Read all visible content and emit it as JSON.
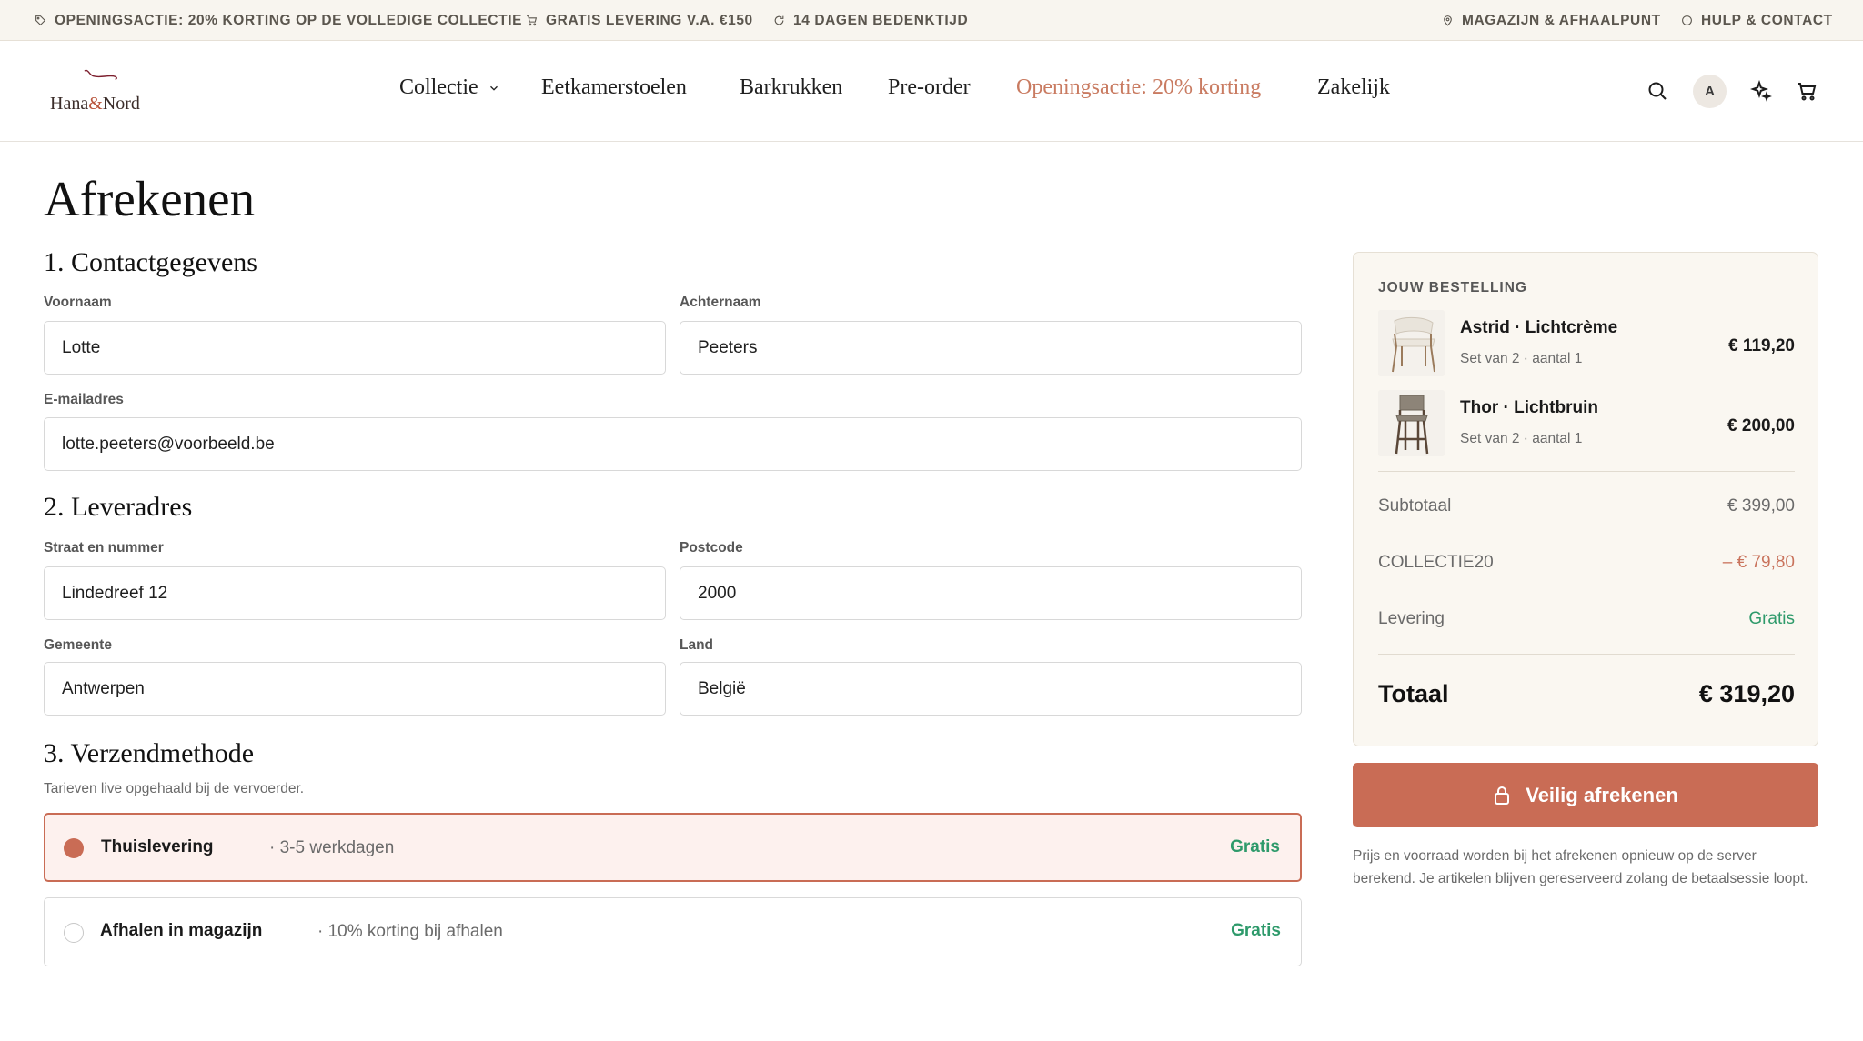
{
  "topbar": {
    "promo": "OPENINGSACTIE: 20% KORTING OP DE VOLLEDIGE COLLECTIE",
    "delivery": "GRATIS LEVERING V.A. €150",
    "return": "14 DAGEN BEDENKTIJD",
    "store": "MAGAZIJN & AFHAALPUNT",
    "help": "HULP & CONTACT"
  },
  "header": {
    "logo": {
      "name_a": "Hana",
      "amp": "&",
      "name_b": "Nord"
    },
    "nav": [
      "Collectie",
      "Eetkamerstoelen",
      "Barkrukken",
      "Pre-order",
      "Openingsactie: 20% korting",
      "Zakelijk"
    ],
    "avatar_initial": "A",
    "icons": [
      "search-icon",
      "sparkle-icon",
      "cart-icon"
    ]
  },
  "page": {
    "title": "Afrekenen"
  },
  "contact": {
    "title": "1. Contactgegevens",
    "first_name_label": "Voornaam",
    "first_name": "Lotte",
    "last_name_label": "Achternaam",
    "last_name": "Peeters",
    "email_label": "E-mailadres",
    "email": "lotte.peeters@voorbeeld.be"
  },
  "address": {
    "title": "2. Leveradres",
    "street_label": "Straat en nummer",
    "street": "Lindedreef 12",
    "postcode_label": "Postcode",
    "postcode": "2000",
    "city_label": "Gemeente",
    "city": "Antwerpen",
    "country_label": "Land",
    "country": "België"
  },
  "shipping": {
    "title": "3. Verzendmethode",
    "hint": "Tarieven live opgehaald bij de vervoerder.",
    "options": [
      {
        "name": "Thuislevering",
        "note": "· 3-5 werkdagen",
        "price": "Gratis",
        "selected": true
      },
      {
        "name": "Afhalen in magazijn",
        "note": "· 10% korting bij afhalen",
        "price": "Gratis",
        "selected": false
      }
    ]
  },
  "summary": {
    "title": "JOUW BESTELLING",
    "items": [
      {
        "name": "Astrid · Lichtcrème",
        "meta": "Set van 2 · aantal 1",
        "price": "€ 119,20"
      },
      {
        "name": "Thor · Lichtbruin",
        "meta": "Set van 2 · aantal 1",
        "price": "€ 200,00"
      }
    ],
    "subtotal_label": "Subtotaal",
    "subtotal": "€ 399,00",
    "discount_label": "COLLECTIE20",
    "discount": "– € 79,80",
    "delivery_label": "Levering",
    "delivery": "Gratis",
    "total_label": "Totaal",
    "total": "€ 319,20"
  },
  "checkout": {
    "button": "Veilig afrekenen",
    "disclaimer": "Prijs en voorraad worden bij het afrekenen opnieuw op de server berekend. Je artikelen blijven gereserveerd zolang de betaalsessie loopt."
  },
  "colors": {
    "accent": "#c96c55",
    "success": "#2e9a6b",
    "promo_text": "#c97b61",
    "topbar_bg": "#f8f5ef",
    "summary_bg": "#faf7f1"
  }
}
